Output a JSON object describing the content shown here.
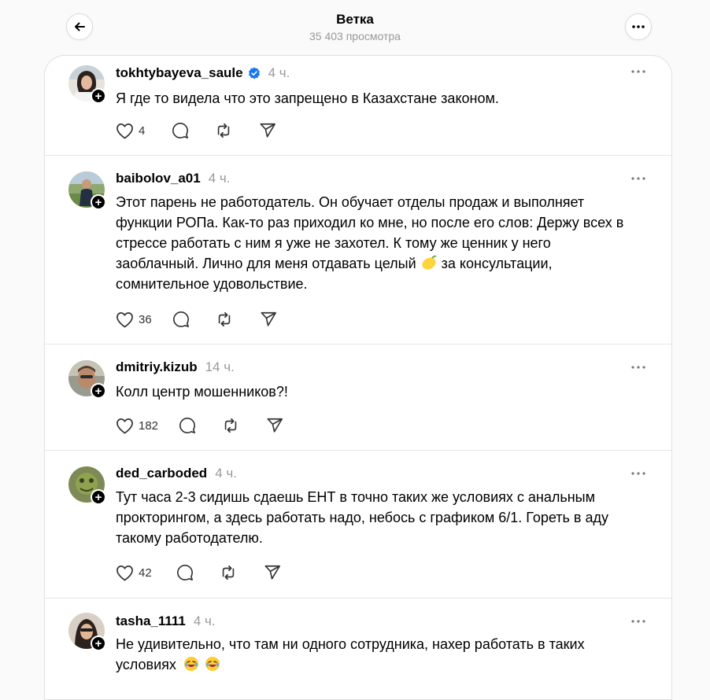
{
  "header": {
    "title": "Ветка",
    "views": "35 403 просмотра"
  },
  "colors": {
    "verified": "#1877f2",
    "muted": "#999999",
    "divider": "#e6e6e6"
  },
  "icons": [
    "arrow-left-icon",
    "more-icon",
    "plus-icon",
    "verified-icon",
    "heart-icon",
    "comment-icon",
    "repost-icon",
    "share-icon",
    "lemon-emoji",
    "laughing-emoji"
  ],
  "posts": [
    {
      "username": "tokhtybayeva_saule",
      "verified": true,
      "time": "4 ч.",
      "text": "Я где то видела что это запрещено в Казахстане законом.",
      "likes": "4"
    },
    {
      "username": "baibolov_a01",
      "time": "4 ч.",
      "text_line1": "Этот парень не работодатель. Он обучает отделы продаж и выполняет",
      "text_line2": "функции РОПа. Как-то раз приходил ко мне, но после его слов: Держу всех в",
      "text_line3": "стрессе работать с ним я уже не захотел. К тому же ценник у него",
      "text_line4_before": "заоблачный. Лично для меня отдавать целый",
      "text_line4_after": "за консультации,",
      "text_line5": "сомнительное удовольствие.",
      "likes": "36"
    },
    {
      "username": "dmitriy.kizub",
      "time": "14 ч.",
      "text": "Колл центр мошенников?!",
      "likes": "182"
    },
    {
      "username": "ded_carboded",
      "time": "4 ч.",
      "text_line1": "Тут часа 2-3 сидишь сдаешь ЕНТ в точно таких же условиях с анальным",
      "text_line2": "прокторингом, а здесь работать надо, небось с графиком 6/1. Гореть в аду",
      "text_line3": "такому работодателю.",
      "likes": "42"
    },
    {
      "username": "tasha_1111",
      "time": "4 ч.",
      "text_line1": "Не удивительно, что там ни одного сотрудника, нахер работать в таких",
      "text_line2": "условиях"
    }
  ]
}
